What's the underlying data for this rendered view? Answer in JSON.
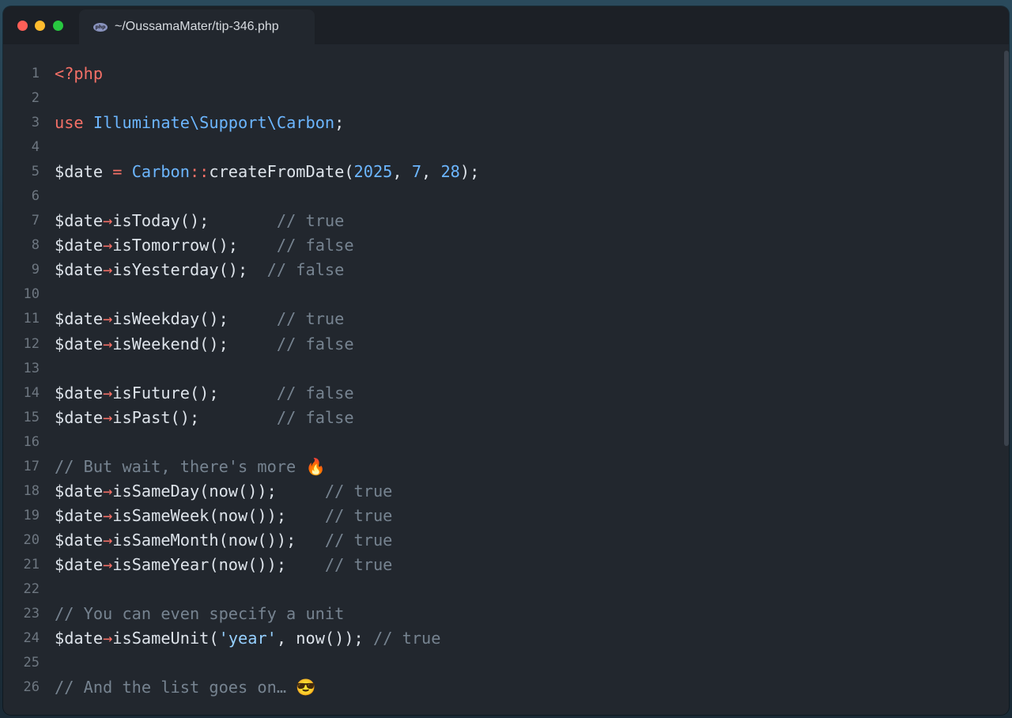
{
  "window": {
    "tab_title": "~/OussamaMater/tip-346.php",
    "tab_icon": "php-icon"
  },
  "lines": [
    {
      "n": "1",
      "tokens": [
        {
          "t": "<?php",
          "c": "kw"
        }
      ]
    },
    {
      "n": "2",
      "tokens": []
    },
    {
      "n": "3",
      "tokens": [
        {
          "t": "use",
          "c": "kw"
        },
        {
          "t": " "
        },
        {
          "t": "Illuminate\\Support\\Carbon",
          "c": "ty"
        },
        {
          "t": ";"
        }
      ]
    },
    {
      "n": "4",
      "tokens": []
    },
    {
      "n": "5",
      "tokens": [
        {
          "t": "$date"
        },
        {
          "t": " = ",
          "c": "op"
        },
        {
          "t": "Carbon",
          "c": "ty"
        },
        {
          "t": "::",
          "c": "op"
        },
        {
          "t": "createFromDate("
        },
        {
          "t": "2025",
          "c": "nm"
        },
        {
          "t": ", "
        },
        {
          "t": "7",
          "c": "nm"
        },
        {
          "t": ", "
        },
        {
          "t": "28",
          "c": "nm"
        },
        {
          "t": ");"
        }
      ]
    },
    {
      "n": "6",
      "tokens": []
    },
    {
      "n": "7",
      "tokens": [
        {
          "t": "$date"
        },
        {
          "t": "→",
          "c": "op"
        },
        {
          "t": "isToday();       "
        },
        {
          "t": "// true",
          "c": "cm"
        }
      ]
    },
    {
      "n": "8",
      "tokens": [
        {
          "t": "$date"
        },
        {
          "t": "→",
          "c": "op"
        },
        {
          "t": "isTomorrow();    "
        },
        {
          "t": "// false",
          "c": "cm"
        }
      ]
    },
    {
      "n": "9",
      "tokens": [
        {
          "t": "$date"
        },
        {
          "t": "→",
          "c": "op"
        },
        {
          "t": "isYesterday();  "
        },
        {
          "t": "// false",
          "c": "cm"
        }
      ]
    },
    {
      "n": "10",
      "tokens": []
    },
    {
      "n": "11",
      "tokens": [
        {
          "t": "$date"
        },
        {
          "t": "→",
          "c": "op"
        },
        {
          "t": "isWeekday();     "
        },
        {
          "t": "// true",
          "c": "cm"
        }
      ]
    },
    {
      "n": "12",
      "tokens": [
        {
          "t": "$date"
        },
        {
          "t": "→",
          "c": "op"
        },
        {
          "t": "isWeekend();     "
        },
        {
          "t": "// false",
          "c": "cm"
        }
      ]
    },
    {
      "n": "13",
      "tokens": []
    },
    {
      "n": "14",
      "tokens": [
        {
          "t": "$date"
        },
        {
          "t": "→",
          "c": "op"
        },
        {
          "t": "isFuture();      "
        },
        {
          "t": "// false",
          "c": "cm"
        }
      ]
    },
    {
      "n": "15",
      "tokens": [
        {
          "t": "$date"
        },
        {
          "t": "→",
          "c": "op"
        },
        {
          "t": "isPast();        "
        },
        {
          "t": "// false",
          "c": "cm"
        }
      ]
    },
    {
      "n": "16",
      "tokens": []
    },
    {
      "n": "17",
      "tokens": [
        {
          "t": "// But wait, there's more 🔥",
          "c": "cm"
        }
      ]
    },
    {
      "n": "18",
      "tokens": [
        {
          "t": "$date"
        },
        {
          "t": "→",
          "c": "op"
        },
        {
          "t": "isSameDay(now());     "
        },
        {
          "t": "// true",
          "c": "cm"
        }
      ]
    },
    {
      "n": "19",
      "tokens": [
        {
          "t": "$date"
        },
        {
          "t": "→",
          "c": "op"
        },
        {
          "t": "isSameWeek(now());    "
        },
        {
          "t": "// true",
          "c": "cm"
        }
      ]
    },
    {
      "n": "20",
      "tokens": [
        {
          "t": "$date"
        },
        {
          "t": "→",
          "c": "op"
        },
        {
          "t": "isSameMonth(now());   "
        },
        {
          "t": "// true",
          "c": "cm"
        }
      ]
    },
    {
      "n": "21",
      "tokens": [
        {
          "t": "$date"
        },
        {
          "t": "→",
          "c": "op"
        },
        {
          "t": "isSameYear(now());    "
        },
        {
          "t": "// true",
          "c": "cm"
        }
      ]
    },
    {
      "n": "22",
      "tokens": []
    },
    {
      "n": "23",
      "tokens": [
        {
          "t": "// You can even specify a unit",
          "c": "cm"
        }
      ]
    },
    {
      "n": "24",
      "tokens": [
        {
          "t": "$date"
        },
        {
          "t": "→",
          "c": "op"
        },
        {
          "t": "isSameUnit("
        },
        {
          "t": "'year'",
          "c": "st"
        },
        {
          "t": ", now()); "
        },
        {
          "t": "// true",
          "c": "cm"
        }
      ]
    },
    {
      "n": "25",
      "tokens": []
    },
    {
      "n": "26",
      "tokens": [
        {
          "t": "// And the list goes on… 😎",
          "c": "cm"
        }
      ]
    }
  ]
}
